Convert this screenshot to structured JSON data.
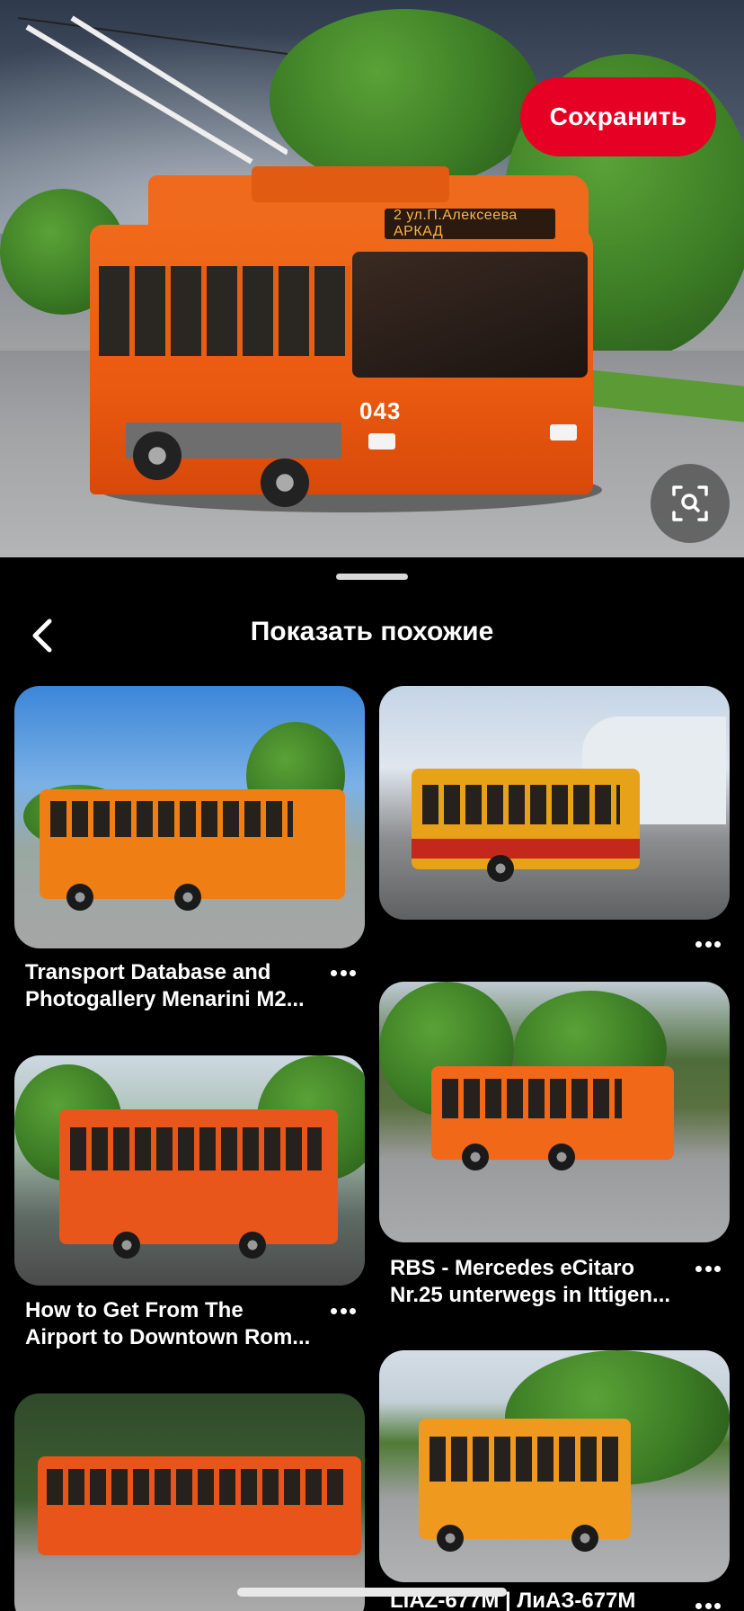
{
  "hero": {
    "destination_sign": "2 ул.П.Алексеева АРКАД",
    "fleet_number": "043",
    "save_button": "Сохранить",
    "lens_icon": "visual-search-icon"
  },
  "sheet": {
    "back_icon": "chevron-left-icon",
    "title": "Показать похожие"
  },
  "pins": [
    {
      "title_line1": "Transport Database and",
      "title_line2": "Photogallery Menarini M2...",
      "more_icon": "more-horizontal-icon",
      "colors": {
        "sky": "#3d86d8",
        "bus": "#f07d14"
      }
    },
    {
      "title_line1": "",
      "title_line2": "",
      "more_icon": "more-horizontal-icon",
      "colors": {
        "sky": "#c9d6e6",
        "bus": "#e8a21a"
      }
    },
    {
      "title_line1": "How to Get From The",
      "title_line2": "Airport to Downtown Rom...",
      "more_icon": "more-horizontal-icon",
      "colors": {
        "sky": "#d6e2ea",
        "bus": "#e8561c"
      }
    },
    {
      "title_line1": "RBS - Mercedes eCitaro",
      "title_line2": "Nr.25 unterwegs in Ittigen...",
      "more_icon": "more-horizontal-icon",
      "colors": {
        "sky": "#cfd9e2",
        "bus": "#f06818"
      }
    },
    {
      "title_line1": "",
      "title_line2": "",
      "more_icon": "",
      "colors": {
        "sky": "#2f4a2a",
        "bus": "#e8541a"
      }
    },
    {
      "title_line1": "LiAZ-677M | ЛиАЗ-677М",
      "title_line2": "",
      "more_icon": "more-horizontal-icon",
      "colors": {
        "sky": "#d4dde6",
        "bus": "#ef9a1e"
      }
    }
  ]
}
